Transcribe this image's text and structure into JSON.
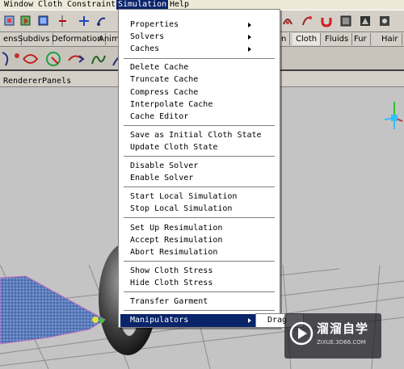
{
  "menubar": {
    "items": [
      "Window",
      "Cloth",
      "Constraints",
      "Simulation",
      "Help"
    ],
    "active": "Simulation"
  },
  "shelf_tabs": [
    "ens",
    "Subdivs",
    "Deformation",
    "Anim",
    "n",
    "Cloth",
    "Fluids",
    "Fur",
    "Hair"
  ],
  "panel_menu": [
    "Renderer",
    "Panels"
  ],
  "simulation_menu": {
    "items": [
      "Properties",
      "Solvers",
      "Caches",
      "Delete Cache",
      "Truncate Cache",
      "Compress Cache",
      "Interpolate Cache",
      "Cache Editor",
      "Save as Initial Cloth State",
      "Update Cloth State",
      "Disable Solver",
      "Enable Solver",
      "Start Local Simulation",
      "Stop Local Simulation",
      "Set Up Resimulation",
      "Accept Resimulation",
      "Abort Resimulation",
      "Show Cloth Stress",
      "Hide Cloth Stress",
      "Transfer Garment",
      "Manipulators"
    ],
    "submenu_items": [
      "Properties",
      "Solvers",
      "Caches",
      "Manipulators"
    ],
    "highlighted": "Manipulators"
  },
  "manipulators_submenu": {
    "first_item": "Drag"
  },
  "watermark": {
    "title": "溜溜自学",
    "url": "ZIXUE.3D66.COM"
  },
  "colors": {
    "menu_highlight": "#0a246a",
    "viewport_bg": "#c4c4c4",
    "cloth": "#5a7ab8",
    "toolbar_bg": "#d4d0c8"
  }
}
